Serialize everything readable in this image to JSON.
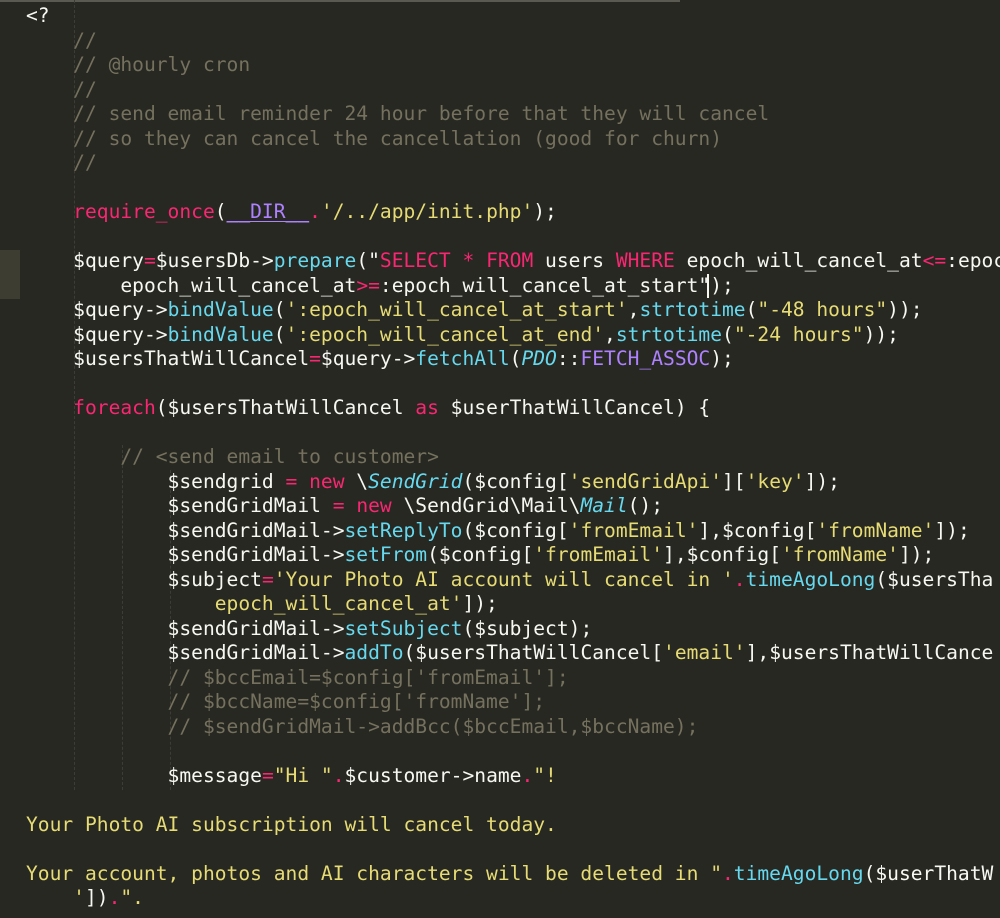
{
  "colors": {
    "background": "#272822",
    "plain": "#f8f8f2",
    "comment": "#75715e",
    "keyword": "#f92672",
    "string": "#e6db74",
    "function": "#66d9ef",
    "constant": "#ae81ff"
  },
  "code": {
    "lines": [
      [
        [
          "p",
          "<?"
        ]
      ],
      [
        [
          "c",
          "    //"
        ]
      ],
      [
        [
          "c",
          "    // @hourly cron"
        ]
      ],
      [
        [
          "c",
          "    //"
        ]
      ],
      [
        [
          "c",
          "    // send email reminder 24 hour before that they will cancel"
        ]
      ],
      [
        [
          "c",
          "    // so they can cancel the cancellation (good for churn)"
        ]
      ],
      [
        [
          "c",
          "    //"
        ]
      ],
      [],
      [
        [
          "k",
          "    require_once"
        ],
        [
          "p",
          "("
        ],
        [
          "u",
          "__DIR__"
        ],
        [
          "k",
          "."
        ],
        [
          "s",
          "'/../app/init.php'"
        ],
        [
          "p",
          ");"
        ]
      ],
      [],
      [
        [
          "p",
          "    $query"
        ],
        [
          "k",
          "="
        ],
        [
          "p",
          "$usersDb->"
        ],
        [
          "f",
          "prepare"
        ],
        [
          "p",
          "(\""
        ],
        [
          "k",
          "SELECT * FROM"
        ],
        [
          "p",
          " users "
        ],
        [
          "k",
          "WHERE"
        ],
        [
          "p",
          " epoch_will_cancel_at"
        ],
        [
          "k",
          "<="
        ],
        [
          "p",
          ":epoch"
        ]
      ],
      [
        [
          "p",
          "        epoch_will_cancel_at"
        ],
        [
          "k",
          ">="
        ],
        [
          "p",
          ":epoch_will_cancel_at_start\");"
        ]
      ],
      [
        [
          "p",
          "    $query->"
        ],
        [
          "f",
          "bindValue"
        ],
        [
          "p",
          "("
        ],
        [
          "s",
          "':epoch_will_cancel_at_start'"
        ],
        [
          "p",
          ","
        ],
        [
          "f",
          "strtotime"
        ],
        [
          "p",
          "("
        ],
        [
          "s",
          "\"-48 hours\""
        ],
        [
          "p",
          "));"
        ]
      ],
      [
        [
          "p",
          "    $query->"
        ],
        [
          "f",
          "bindValue"
        ],
        [
          "p",
          "("
        ],
        [
          "s",
          "':epoch_will_cancel_at_end'"
        ],
        [
          "p",
          ","
        ],
        [
          "f",
          "strtotime"
        ],
        [
          "p",
          "("
        ],
        [
          "s",
          "\"-24 hours\""
        ],
        [
          "p",
          "));"
        ]
      ],
      [
        [
          "p",
          "    $usersThatWillCancel"
        ],
        [
          "k",
          "="
        ],
        [
          "p",
          "$query->"
        ],
        [
          "f",
          "fetchAll"
        ],
        [
          "p",
          "("
        ],
        [
          "i",
          "PDO"
        ],
        [
          "p",
          "::"
        ],
        [
          "v",
          "FETCH_ASSOC"
        ],
        [
          "p",
          ");"
        ]
      ],
      [],
      [
        [
          "k",
          "    foreach"
        ],
        [
          "p",
          "($usersThatWillCancel "
        ],
        [
          "k",
          "as"
        ],
        [
          "p",
          " $userThatWillCancel) {"
        ]
      ],
      [],
      [
        [
          "c",
          "        // <send email to customer>"
        ]
      ],
      [
        [
          "p",
          "            $sendgrid "
        ],
        [
          "k",
          "="
        ],
        [
          "p",
          " "
        ],
        [
          "k",
          "new"
        ],
        [
          "p",
          " \\"
        ],
        [
          "i",
          "SendGrid"
        ],
        [
          "p",
          "($config["
        ],
        [
          "s",
          "'sendGridApi'"
        ],
        [
          "p",
          "]["
        ],
        [
          "s",
          "'key'"
        ],
        [
          "p",
          "]);"
        ]
      ],
      [
        [
          "p",
          "            $sendGridMail "
        ],
        [
          "k",
          "="
        ],
        [
          "p",
          " "
        ],
        [
          "k",
          "new"
        ],
        [
          "p",
          " \\SendGrid\\Mail\\"
        ],
        [
          "i",
          "Mail"
        ],
        [
          "p",
          "();"
        ]
      ],
      [
        [
          "p",
          "            $sendGridMail->"
        ],
        [
          "f",
          "setReplyTo"
        ],
        [
          "p",
          "($config["
        ],
        [
          "s",
          "'fromEmail'"
        ],
        [
          "p",
          "],$config["
        ],
        [
          "s",
          "'fromName'"
        ],
        [
          "p",
          "]);"
        ]
      ],
      [
        [
          "p",
          "            $sendGridMail->"
        ],
        [
          "f",
          "setFrom"
        ],
        [
          "p",
          "($config["
        ],
        [
          "s",
          "'fromEmail'"
        ],
        [
          "p",
          "],$config["
        ],
        [
          "s",
          "'fromName'"
        ],
        [
          "p",
          "]);"
        ]
      ],
      [
        [
          "p",
          "            $subject"
        ],
        [
          "k",
          "="
        ],
        [
          "s",
          "'Your Photo AI account will cancel in '"
        ],
        [
          "k",
          "."
        ],
        [
          "f",
          "timeAgoLong"
        ],
        [
          "p",
          "($usersTha"
        ]
      ],
      [
        [
          "s",
          "                epoch_will_cancel_at'"
        ],
        [
          "p",
          "]);"
        ]
      ],
      [
        [
          "p",
          "            $sendGridMail->"
        ],
        [
          "f",
          "setSubject"
        ],
        [
          "p",
          "($subject);"
        ]
      ],
      [
        [
          "p",
          "            $sendGridMail->"
        ],
        [
          "f",
          "addTo"
        ],
        [
          "p",
          "($usersThatWillCancel["
        ],
        [
          "s",
          "'email'"
        ],
        [
          "p",
          "],$usersThatWillCance"
        ]
      ],
      [
        [
          "c",
          "            // $bccEmail=$config['fromEmail'];"
        ]
      ],
      [
        [
          "c",
          "            // $bccName=$config['fromName'];"
        ]
      ],
      [
        [
          "c",
          "            // $sendGridMail->addBcc($bccEmail,$bccName);"
        ]
      ],
      [],
      [
        [
          "p",
          "            $message"
        ],
        [
          "k",
          "="
        ],
        [
          "s",
          "\"Hi \""
        ],
        [
          "k",
          "."
        ],
        [
          "p",
          "$customer->name"
        ],
        [
          "k",
          "."
        ],
        [
          "s",
          "\"!"
        ]
      ],
      [],
      [
        [
          "s",
          "Your Photo AI subscription will cancel today."
        ]
      ],
      [],
      [
        [
          "s",
          "Your account, photos and AI characters will be deleted in \""
        ],
        [
          "k",
          "."
        ],
        [
          "f",
          "timeAgoLong"
        ],
        [
          "p",
          "($userThatW"
        ]
      ],
      [
        [
          "s",
          "    '"
        ],
        [
          "p",
          "])"
        ],
        [
          "k",
          "."
        ],
        [
          "s",
          "\"."
        ]
      ]
    ]
  }
}
